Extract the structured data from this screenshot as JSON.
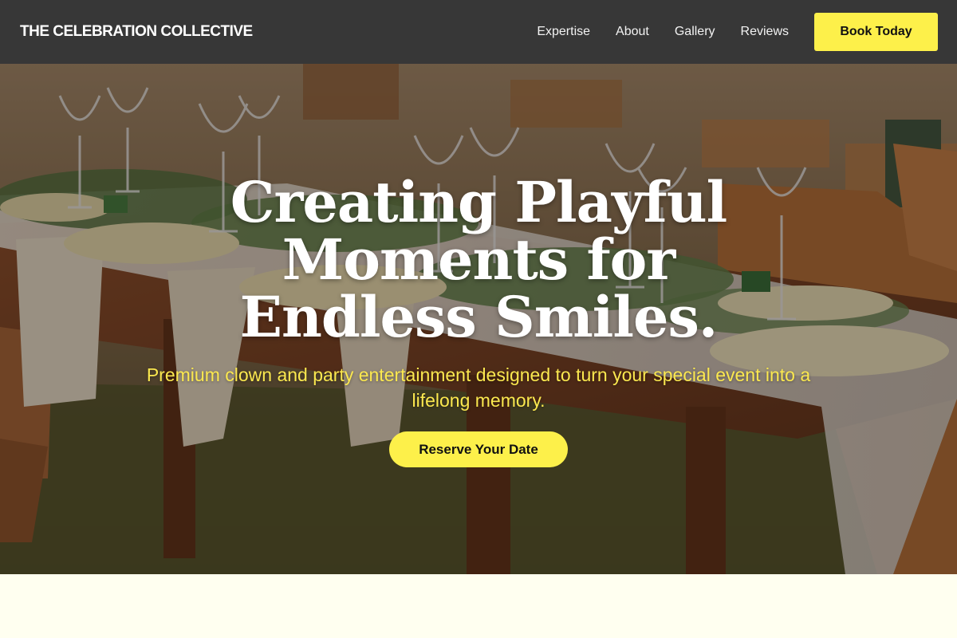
{
  "header": {
    "brand": "THE CELEBRATION COLLECTIVE",
    "nav": [
      "Expertise",
      "About",
      "Gallery",
      "Reviews"
    ],
    "cta_label": "Book Today"
  },
  "hero": {
    "headline": "Creating Playful Moments for Endless Smiles.",
    "subheadline": "Premium clown and party entertainment designed to turn your special event into a lifelong memory.",
    "cta_label": "Reserve Your Date",
    "background_image": "rustic wooden banquet table with wine glasses, plates, napkins and greenery garland, wooden folding chairs on grass"
  },
  "colors": {
    "header_bg": "#373737",
    "accent_yellow": "#fdf04a",
    "subheadline_yellow": "#fbe84f",
    "page_bg": "#fffff0"
  }
}
